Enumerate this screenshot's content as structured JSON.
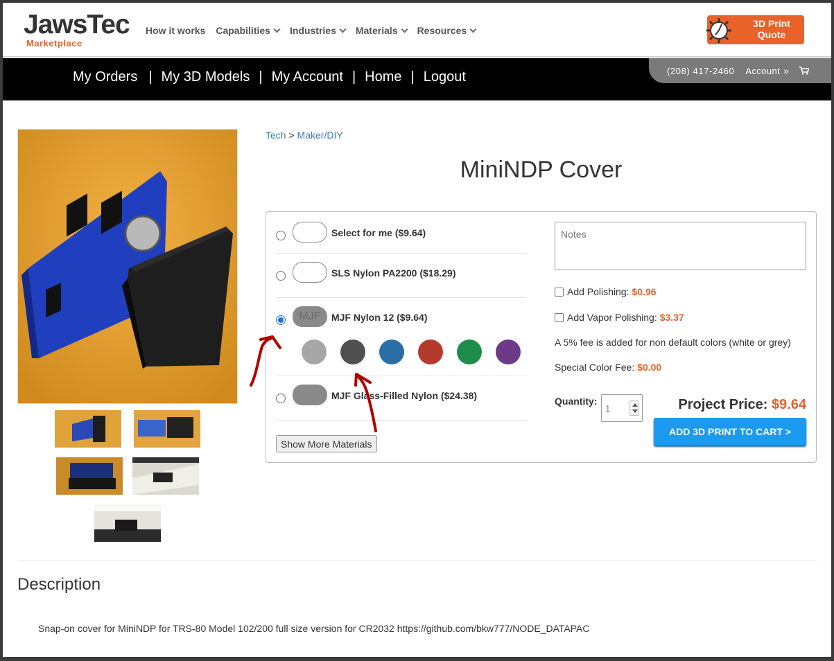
{
  "brand": {
    "name_part1": "Jaws",
    "name_part2": "Tec",
    "sub": "Marketplace"
  },
  "nav": {
    "items": [
      {
        "label": "How it works",
        "has_dropdown": false
      },
      {
        "label": "Capabilities",
        "has_dropdown": true
      },
      {
        "label": "Industries",
        "has_dropdown": true
      },
      {
        "label": "Materials",
        "has_dropdown": true
      },
      {
        "label": "Resources",
        "has_dropdown": true
      }
    ]
  },
  "quote_button": {
    "line1": "3D Print",
    "line2": "Quote"
  },
  "user_nav": {
    "items": [
      "My Orders",
      "My 3D Models",
      "My Account",
      "Home",
      "Logout"
    ],
    "separator": "|"
  },
  "contact": {
    "phone": "(208) 417-2460",
    "account_label": "Account",
    "account_icon": "double-chevron-right",
    "cart_icon": "cart"
  },
  "breadcrumb": {
    "item1": "Tech",
    "separator": ">",
    "item2": "Maker/DIY"
  },
  "product": {
    "title": "MiniNDP Cover"
  },
  "materials": [
    {
      "label": "Select for me ($9.64)",
      "swatch": "white",
      "selected": false
    },
    {
      "label": "SLS Nylon PA2200 ($18.29)",
      "swatch": "white",
      "selected": false
    },
    {
      "label": "MJF Nylon 12 ($9.64)",
      "swatch": "gray",
      "swatch_text": "MJF",
      "selected": true
    },
    {
      "label": "MJF Glass-Filled Nylon ($24.38)",
      "swatch": "gray",
      "selected": false
    }
  ],
  "colors": [
    "#a6a6a6",
    "#505050",
    "#2a6ea8",
    "#b53a2e",
    "#1e8c4a",
    "#6c3a86"
  ],
  "show_more_label": "Show More Materials",
  "options": {
    "notes_placeholder": "Notes",
    "polishing_label": "Add Polishing:",
    "polishing_price": "$0.96",
    "vapor_label": "Add Vapor Polishing:",
    "vapor_price": "$3.37",
    "fee_note": "A 5% fee is added for non default colors (white or grey)",
    "color_fee_label": "Special Color Fee:",
    "color_fee_price": "$0.00"
  },
  "quantity": {
    "label": "Quantity:",
    "value": "1"
  },
  "project_price": {
    "label": "Project Price:",
    "value": "$9.64"
  },
  "add_to_cart_label": "ADD 3D PRINT TO CART >",
  "description": {
    "heading": "Description",
    "text": "Snap-on cover for MiniNDP for TRS-80 Model 102/200 full size version for CR2032 https://github.com/bkw777/NODE_DATAPAC"
  },
  "theme": {
    "accent": "#e8622a",
    "link": "#3a7bbf",
    "button_blue": "#1a9bf0",
    "annotation_red": "#b00000"
  }
}
